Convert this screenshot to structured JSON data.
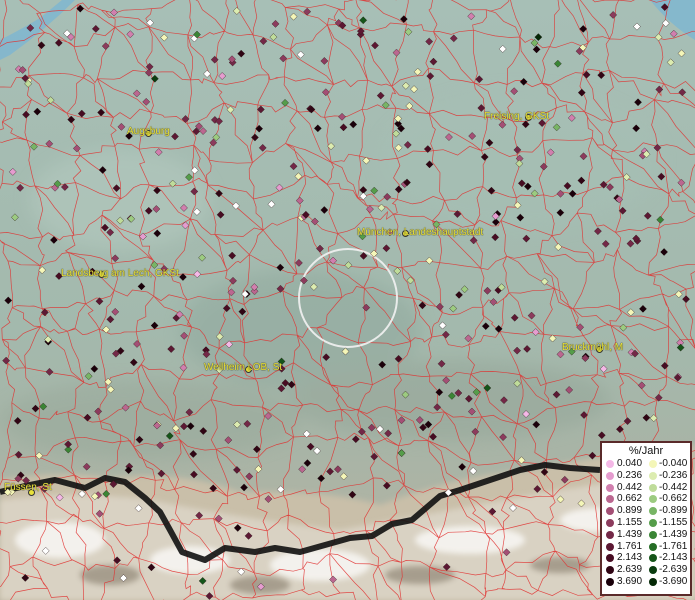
{
  "map": {
    "places": [
      {
        "name": "Augsburg"
      },
      {
        "name": "Freising, GKSt"
      },
      {
        "name": "München, Landeshauptstadt"
      },
      {
        "name": "Landsberg am Lech, GKSt"
      },
      {
        "name": "Weilheim i.OB, St"
      },
      {
        "name": "Bruckmühl, M"
      },
      {
        "name": "Füssen, St"
      }
    ]
  },
  "legend": {
    "title": "%/Jahr",
    "positive": [
      {
        "label": "0.040",
        "color": "#f4b8e6"
      },
      {
        "label": "0.236",
        "color": "#e59ccf"
      },
      {
        "label": "0.442",
        "color": "#d17fae"
      },
      {
        "label": "0.662",
        "color": "#bb6790"
      },
      {
        "label": "0.899",
        "color": "#a44f75"
      },
      {
        "label": "1.155",
        "color": "#8c3b5d"
      },
      {
        "label": "1.439",
        "color": "#732847"
      },
      {
        "label": "1.761",
        "color": "#5c1833"
      },
      {
        "label": "2.143",
        "color": "#470c22"
      },
      {
        "label": "2.639",
        "color": "#300514"
      },
      {
        "label": "3.690",
        "color": "#1a000a"
      }
    ],
    "negative": [
      {
        "label": "-0.040",
        "color": "#f4f6b8"
      },
      {
        "label": "-0.236",
        "color": "#dcecb0"
      },
      {
        "label": "-0.442",
        "color": "#bfdc9a"
      },
      {
        "label": "-0.662",
        "color": "#9ccb80"
      },
      {
        "label": "-0.899",
        "color": "#78b565"
      },
      {
        "label": "-1.155",
        "color": "#559d4a"
      },
      {
        "label": "-1.439",
        "color": "#3a8535"
      },
      {
        "label": "-1.761",
        "color": "#256d25"
      },
      {
        "label": "-2.143",
        "color": "#155519"
      },
      {
        "label": "-2.639",
        "color": "#0a3d0f"
      },
      {
        "label": "-3.690",
        "color": "#042806"
      }
    ]
  }
}
